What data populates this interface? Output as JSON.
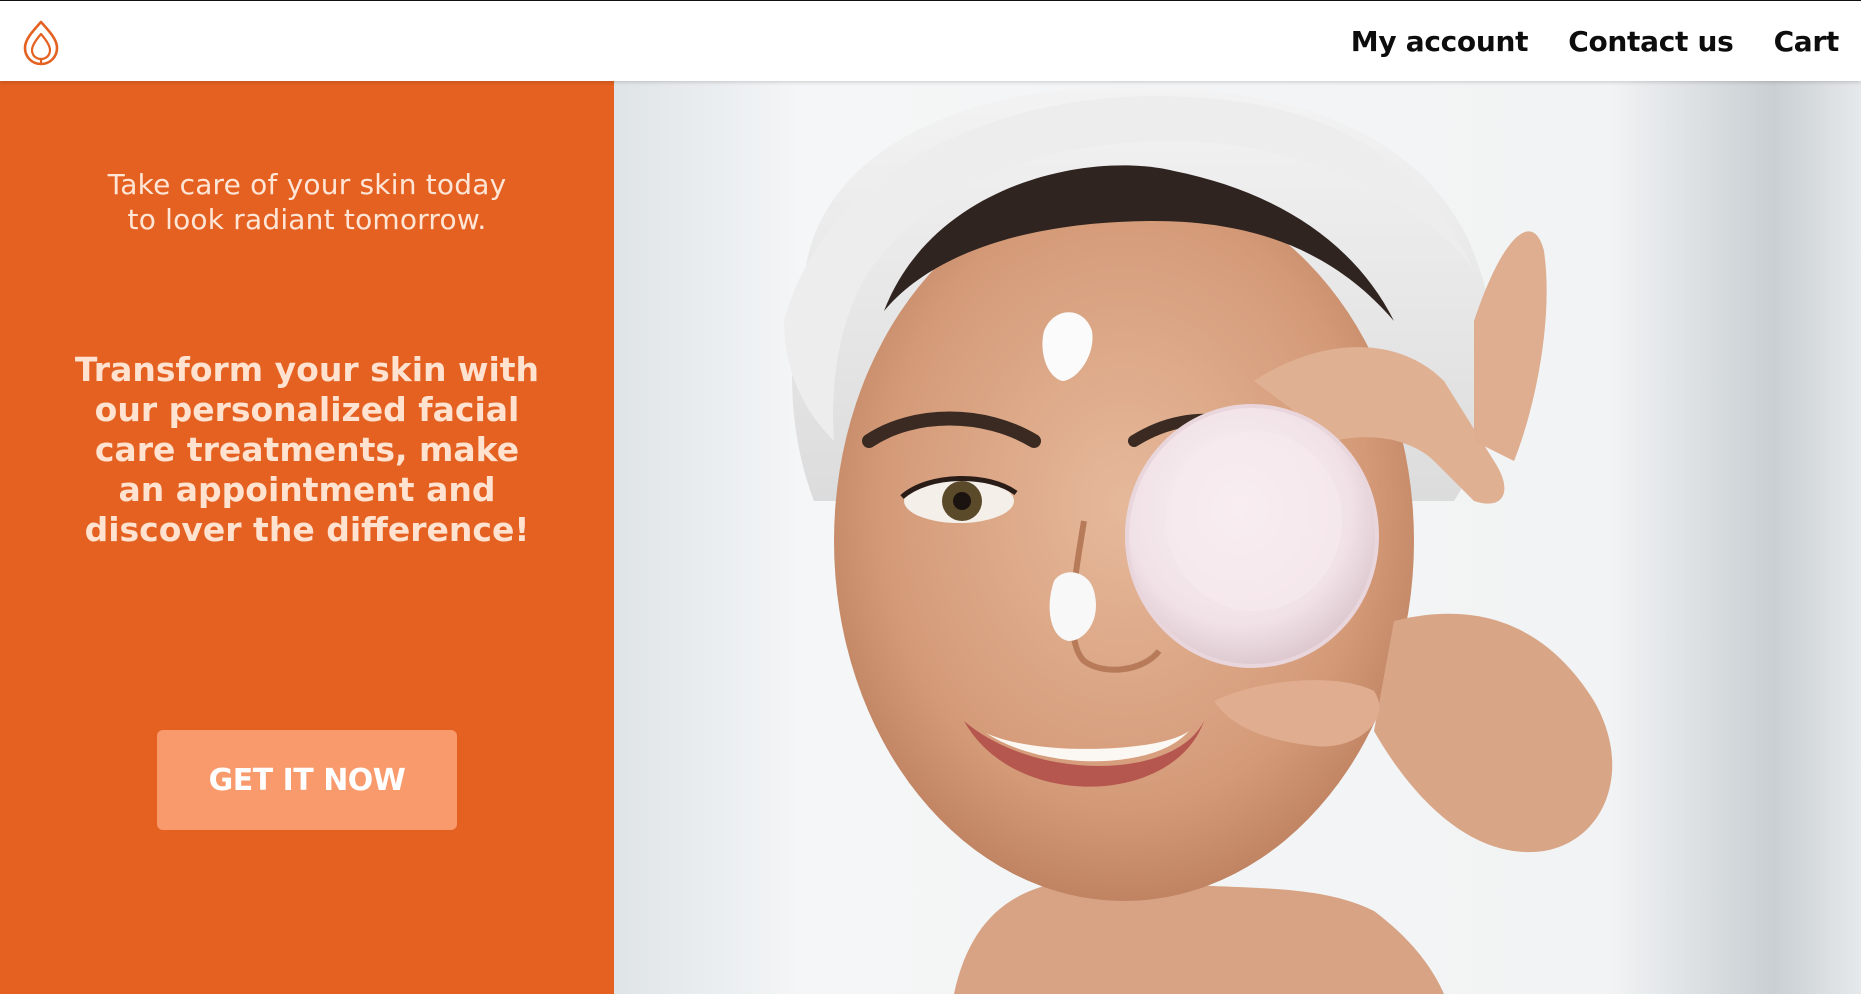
{
  "header": {
    "logo_icon": "leaf-drop-logo-icon",
    "nav": [
      {
        "label": "My account"
      },
      {
        "label": "Contact us"
      },
      {
        "label": "Cart"
      }
    ]
  },
  "hero": {
    "tagline": "Take care of your skin today\nto look radiant tomorrow.",
    "headline": "Transform your skin with our personalized facial care treatments, make an appointment and discover the difference!",
    "cta_label": "GET IT NOW",
    "image_subject": "woman-holding-cream-jar-icon"
  },
  "colors": {
    "accent": "#e46121",
    "button": "#f89a6c",
    "headline_text": "#ffe2cf",
    "nav_text": "#0d0d0d",
    "logo": "#e46121"
  }
}
